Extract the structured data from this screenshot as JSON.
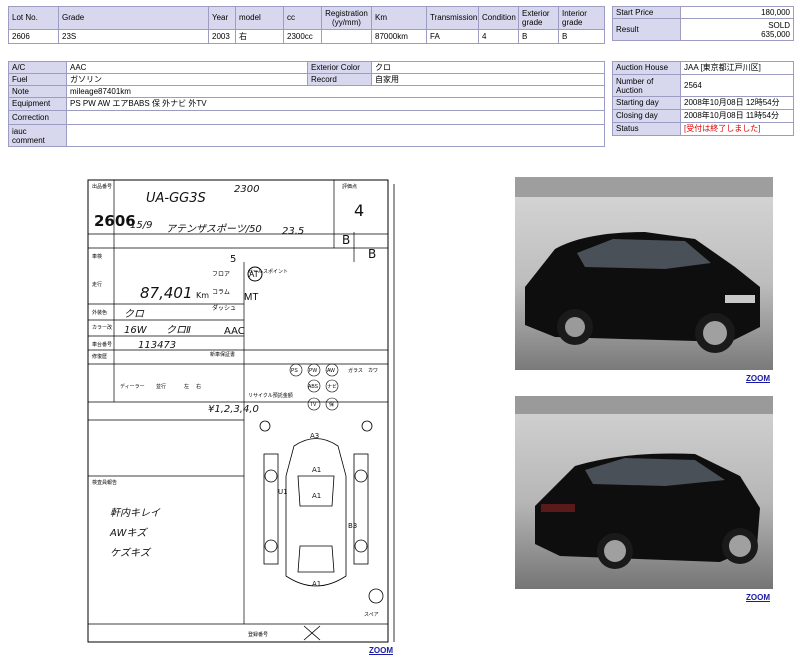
{
  "lot": {
    "headers": [
      "Lot No.",
      "Grade",
      "Year",
      "model",
      "cc",
      "Registration\n(yy/mm)",
      "Km",
      "Transmission",
      "Condition",
      "Exterior\ngrade",
      "Interior\ngrade"
    ],
    "values": [
      "2606",
      "23S",
      "2003",
      "右",
      "2300cc",
      "",
      "87000km",
      "FA",
      "4",
      "B",
      "B"
    ]
  },
  "price": {
    "start_label": "Start Price",
    "start_value": "180,000",
    "result_label": "Result",
    "result_status": "SOLD",
    "result_value": "635,000"
  },
  "details": {
    "ac_label": "A/C",
    "ac_value": "AAC",
    "color_label": "Exterior Color",
    "color_value": "クロ",
    "fuel_label": "Fuel",
    "fuel_value": "ガソリン",
    "record_label": "Record",
    "record_value": "自家用",
    "note_label": "Note",
    "note_value": "mileage87401km",
    "equipment_label": "Equipment",
    "equipment_value": "PS PW AW エアBABS 保 外ナビ 外TV",
    "correction_label": "Correction",
    "correction_value": "",
    "comment_label": "iauc\ncomment",
    "comment_value": ""
  },
  "auction": {
    "house_label": "Auction House",
    "house_value": "JAA [東京都江戸川区]",
    "number_label": "Number of\nAuction",
    "number_value": "2564",
    "start_label": "Starting day",
    "start_value": "2008年10月08日 12時54分",
    "close_label": "Closing day",
    "close_value": "2008年10月08日 11時54分",
    "status_label": "Status",
    "status_value": "[受付は終了しました]",
    "status_color": "#e00000"
  },
  "sheet": {
    "field_labels": [
      "出品番号",
      "車検",
      "走行",
      "外装色",
      "カラー改",
      "車台番号",
      "修復歴",
      "新車保証書",
      "セールスポイント",
      "評価点",
      "リサイクル預託金",
      "検査員報告",
      "登録番号",
      "スペア"
    ],
    "lot_number": "2606",
    "model_code": "UA-GG3S",
    "displacement": "2300",
    "date": "15/9",
    "grade": "アテンザスポーツ/50",
    "grade_code": "23.5",
    "score": "4",
    "interior": "B",
    "exterior": "B",
    "seats": "5",
    "mileage": "87,401",
    "mileage_unit": "Km",
    "trans_options": [
      "フロア",
      "コラム",
      "ダッシュ"
    ],
    "trans_circled": "AT",
    "trans_mt": "MT",
    "color": "クロ",
    "color_code": "16W",
    "color_code2": "クロⅡ",
    "ac": "AAC",
    "chassis": "113473",
    "options": [
      "PS",
      "PW",
      "AW",
      "ABS",
      "ナビ",
      "TV",
      "保",
      "ガラス",
      "カワ"
    ],
    "handle": [
      "ディーラー",
      "並行",
      "左",
      "右"
    ],
    "recycle": "¥1,2,3,4,0",
    "inspector": [
      "軒内キレイ",
      "AWキズ",
      "ケズキズ"
    ],
    "damage": [
      "A3",
      "A1",
      "A1",
      "U1",
      "B3",
      "A1"
    ]
  },
  "photos": {
    "front_label": "ZOOM",
    "rear_label": "ZOOM",
    "sheet_label": "ZOOM"
  }
}
